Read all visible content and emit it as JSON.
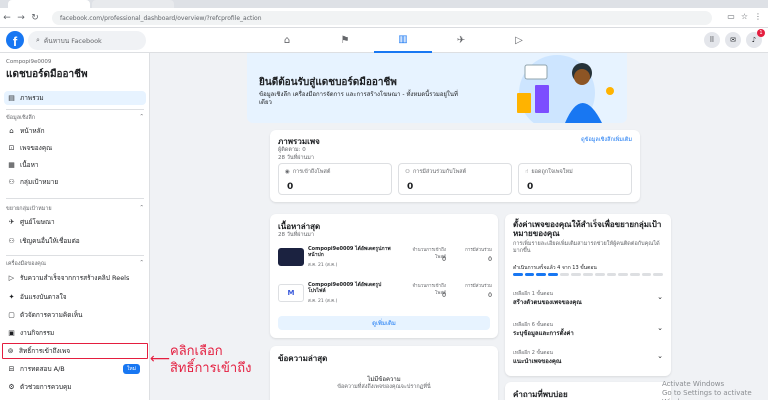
{
  "browser": {
    "url": "facebook.com/professional_dashboard/overview/?refcprofile_action"
  },
  "header": {
    "logo": "f",
    "search_placeholder": "ค้นหาบน Facebook",
    "notification_count": "1"
  },
  "sidebar": {
    "page_id": "Compopi9e0009",
    "title": "แดชบอร์ดมืออาชีพ",
    "overview": "ภาพรวม",
    "sections": [
      {
        "header": "ข้อมูลเชิงลึก",
        "items": [
          "หน้าหลัก",
          "เพจของคุณ",
          "เนื้อหา",
          "กลุ่มเป้าหมาย"
        ]
      },
      {
        "header": "ขยายกลุ่มเป้าหมาย",
        "items": [
          "ศูนย์โฆษณา",
          "เชิญคนอื่นให้เชื่อมต่อ"
        ]
      },
      {
        "header": "เครื่องมือของคุณ",
        "items": [
          "รับความสำเร็จจากการสร้างคลิป Reels",
          "อันแรงบันดาลใจ",
          "ตัวจัดการความคิดเห็น",
          "งานกิจกรรม",
          "สิทธิ์การเข้าถึงเพจ",
          "การทดสอบ A/B",
          "ตัวช่วยการควบคุม"
        ]
      }
    ],
    "ab_badge": "ใหม่"
  },
  "annotation": {
    "line1": "คลิกเลือก",
    "line2": "สิทธิ์การเข้าถึง"
  },
  "banner": {
    "title": "ยินดีต้อนรับสู่แดชบอร์ดมืออาชีพ",
    "subtitle": "ข้อมูลเชิงลึก เครื่องมือการจัดการ และการสร้างโฆษณา - ทั้งหมดนี้รวมอยู่ในที่เดียว"
  },
  "overview_card": {
    "title": "ภาพรวมเพจ",
    "subtitle": "ผู้ติดตาม: 0",
    "period": "28 วันที่ผ่านมา",
    "link": "ดูข้อมูลเชิงลึกเพิ่มเติม",
    "stats": [
      {
        "label": "การเข้าถึงโพสต์",
        "value": "0"
      },
      {
        "label": "การมีส่วนร่วมกับโพสต์",
        "value": "0"
      },
      {
        "label": "ยอดถูกใจเพจใหม่",
        "value": "0"
      }
    ]
  },
  "recent_card": {
    "title": "เนื้อหาล่าสุด",
    "period": "28 วันที่ผ่านมา",
    "col1": "จำนวนการเข้าถึงโพสต์",
    "col2": "การมีส่วนร่วม",
    "posts": [
      {
        "name": "Compopi9e0009 ได้อัพเดตรูปภาพหน้าปก",
        "date": "ส.ค. 21 (ส.ค.)",
        "reach": "0",
        "engagement": "0"
      },
      {
        "name": "Compopi9e0009 ได้อัพเดตรูปโปรไฟล์",
        "date": "ส.ค. 21 (ส.ค.)",
        "reach": "0",
        "engagement": "0"
      }
    ],
    "more_button": "ดูเพิ่มเติม"
  },
  "messages_card": {
    "title": "ข้อความล่าสุด",
    "empty_title": "ไม่มีข้อความ",
    "empty_desc": "ข้อความที่ส่งถึงเพจของคุณจะปรากฏที่นี่"
  },
  "setup_card": {
    "title": "ตั้งค่าเพจของคุณให้สำเร็จเพื่อขยายกลุ่มเป้าหมายของคุณ",
    "desc": "การเพิ่มรายละเอียดเพิ่มเติมสามารถช่วยให้ผู้คนติดต่อกับคุณได้มากขึ้น",
    "progress_label": "ดำเนินการเสร็จแล้ว 4 จาก 13 ขั้นตอน",
    "progress": 0.31,
    "tasks": [
      {
        "label": "เหลืออีก 1 ขั้นตอน",
        "text": "สร้างตัวตนของเพจของคุณ"
      },
      {
        "label": "เหลืออีก 6 ขั้นตอน",
        "text": "ระบุข้อมูลและการตั้งค่า"
      },
      {
        "label": "เหลืออีก 2 ขั้นตอน",
        "text": "แนะนำเพจของคุณ"
      }
    ]
  },
  "faq_card": {
    "title": "คำถามที่พบบ่อย"
  },
  "watermark": {
    "line1": "Activate Windows",
    "line2": "Go to Settings to activate Windows."
  }
}
